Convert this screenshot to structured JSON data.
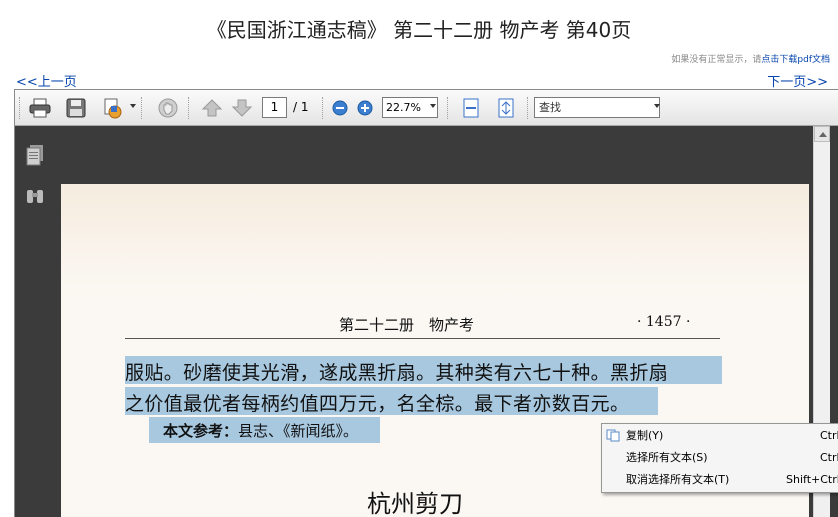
{
  "page": {
    "title": "《民国浙江通志稿》 第二十二册 物产考 第40页",
    "hint_prefix": "如果没有正常显示，请",
    "hint_link": "点击下载pdf文档",
    "prev": "<<上一页",
    "next": "下一页>>"
  },
  "toolbar": {
    "icons": [
      "print-icon",
      "save-icon",
      "attach-icon",
      "hand-tool-icon",
      "page-up-icon",
      "page-down-icon",
      "zoom-out-icon",
      "zoom-in-icon",
      "fit-width-icon",
      "fit-page-icon"
    ],
    "page_value": "1",
    "page_total": "/ 1",
    "zoom_value": "22.7%",
    "search_placeholder": "查找"
  },
  "sidebar": {
    "icons": [
      "pages-panel-icon",
      "search-panel-icon"
    ]
  },
  "document": {
    "running_head": "第二十二册　物产考",
    "page_number": "· 1457 ·",
    "line1": "服贴。砂磨使其光滑，遂成黑折扇。其种类有六七十种。黑折扇",
    "line2": "之价值最优者每柄约值四万元，名全棕。最下者亦数百元。",
    "ref_label": "本文参考：",
    "ref_text": "县志、《新闻纸》。",
    "section_title": "杭州剪刀",
    "highlight_color": "#a8c8e0"
  },
  "context_menu": {
    "items": [
      {
        "label": "复制(Y)",
        "shortcut": "Ctrl"
      },
      {
        "label": "选择所有文本(S)",
        "shortcut": "Ctrl"
      },
      {
        "label": "取消选择所有文本(T)",
        "shortcut": "Shift+Ctrl"
      }
    ]
  }
}
